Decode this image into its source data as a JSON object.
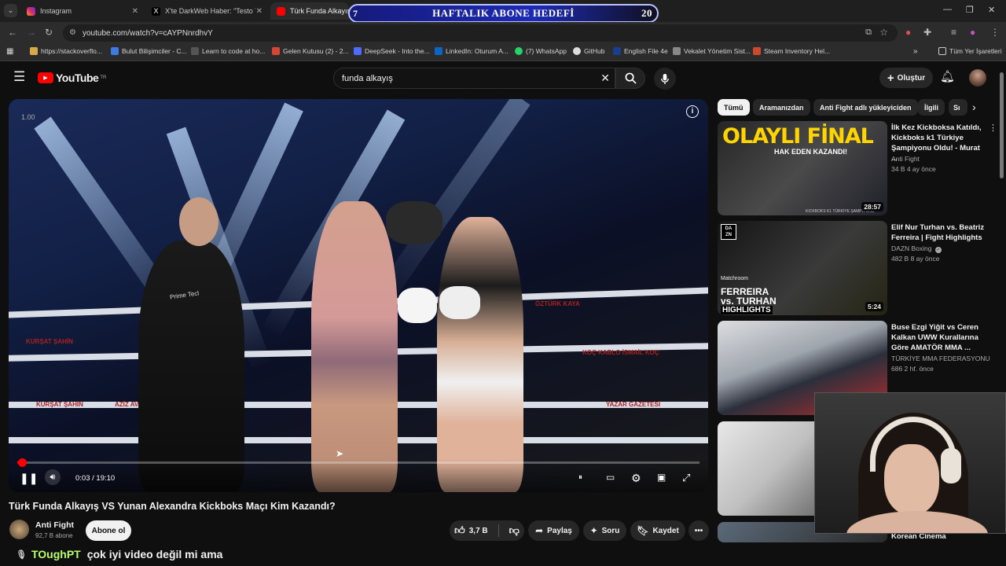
{
  "browser": {
    "tabs": [
      {
        "label": "Instagram"
      },
      {
        "label": "X'te DarkWeb Haber: \"Testo Taylan...\""
      },
      {
        "label": "Türk Funda Alkayış VS"
      }
    ],
    "address": "youtube.com/watch?v=cAYPNnrdhvY",
    "bookmarks": [
      "https://stackoverflo...",
      "Bulut Bilişimciler - C...",
      "Learn to code at ho...",
      "Gelen Kutusu (2) - 2...",
      "DeepSeek - Into the...",
      "LinkedIn: Oturum A...",
      "(7) WhatsApp",
      "GitHub",
      "English File 4e",
      "Vekalet Yönetim Sist...",
      "Steam Inventory Hel..."
    ],
    "all_bookmarks": "Tüm Yer İşaretleri"
  },
  "overlay_goal": {
    "left": "7",
    "label": "HAFTALIK ABONE HEDEFİ",
    "right": "20"
  },
  "youtube": {
    "logo": "YouTube",
    "logo_sup": "TR",
    "search_value": "funda alkayış",
    "create_label": "Oluştur"
  },
  "player": {
    "speed_badge": "1.00",
    "time": "0:03 / 19:10",
    "progress_fraction": 0.003,
    "ring_text": [
      "KURŞAT ŞAHİN",
      "AZİZ AVCI",
      "YAZAR GAZETESİ",
      "KOÇ KABLO İSMAİL KOÇ",
      "ÖZTÜRK KAYA"
    ],
    "shirt_text": "Prime Tecl"
  },
  "video": {
    "title": "Türk Funda Alkayış VS Yunan Alexandra Kickboks Maçı Kim Kazandı?",
    "channel": "Anti Fight",
    "subs": "92,7 B abone",
    "subscribe_label": "Abone ol",
    "likes": "3,7 B",
    "share_label": "Paylaş",
    "ask_label": "Soru",
    "save_label": "Kaydet"
  },
  "chips": [
    "Tümü",
    "Aramanızdan",
    "Anti Fight adlı yükleyiciden",
    "İlgili",
    "Sı"
  ],
  "recommendations": [
    {
      "title": "İlk Kez Kickboksa Katıldı, Kickboks k1 Türkiye Şampiyonu Oldu! - Murat ...",
      "channel": "Anti Fight",
      "meta": "34 B  4 ay önce",
      "duration": "28:57",
      "thumb_big": "OLAYLI FİNAL",
      "thumb_sub": "HAK EDEN KAZANDI!",
      "thumb_foot": "KICKBOKS K1 TÜRKİYE ŞAMPİYONU"
    },
    {
      "title": "Elif Nur Turhan vs. Beatriz Ferreira | Fight Highlights",
      "channel": "DAZN Boxing",
      "meta": "482 B  8 ay önce",
      "duration": "5:24",
      "thumb_big": "FERREIRA",
      "thumb_sub": "vs. TURHAN",
      "thumb_foot": "HIGHLIGHTS",
      "thumb_brand": "DA ZN",
      "thumb_promo": "Matchroom",
      "verified": true
    },
    {
      "title": "Buse Ezgi Yiğit vs Ceren Kalkan UWW Kurallarına Göre AMATÖR MMA ...",
      "channel": "TÜRKİYE MMA FEDERASYONU",
      "meta": "686  2 hf. önce"
    },
    {
      "title": "Korean Cinema",
      "channel": "",
      "meta": ""
    }
  ],
  "chat": {
    "user": "TOughPT",
    "message": "çok iyi video değil mi ama"
  },
  "colors": {
    "accent": "#ff0000",
    "goal_border": "#b9c4ff"
  }
}
